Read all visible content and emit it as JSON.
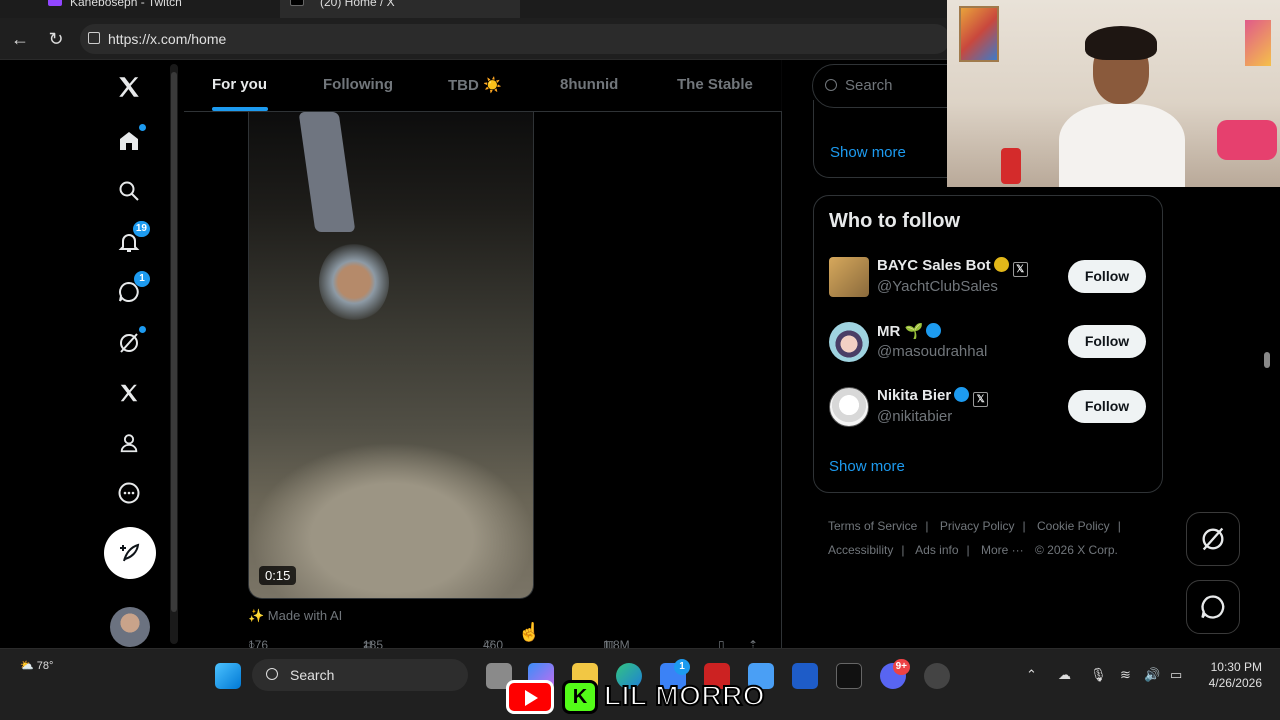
{
  "browser": {
    "tabs": [
      {
        "title": "Kaneboseph - Twitch"
      },
      {
        "title": "(20) Home / X"
      }
    ],
    "url": "https://x.com/home"
  },
  "sidebar": {
    "notifications_badge": "19",
    "messages_badge": "1"
  },
  "timeline": {
    "tabs": [
      {
        "label": "For you",
        "active": true
      },
      {
        "label": "Following"
      },
      {
        "label": "TBD ☀️"
      },
      {
        "label": "8hunnid"
      },
      {
        "label": "The Stable"
      }
    ],
    "post": {
      "duration": "0:15",
      "made_with_ai": "✨ Made with AI",
      "replies": "176",
      "reposts": "185",
      "likes": "460",
      "views": "1.8M"
    }
  },
  "right": {
    "search_placeholder": "Search",
    "show_more_top": "Show more",
    "who_to_follow": {
      "title": "Who to follow",
      "accounts": [
        {
          "name": "BAYC Sales Bot",
          "handle": "@YachtClubSales",
          "follow_label": "Follow",
          "badge_color": "#e2b719"
        },
        {
          "name": "MR 🌱",
          "handle": "@masoudrahhal",
          "follow_label": "Follow",
          "badge_color": "#1d9bf0"
        },
        {
          "name": "Nikita Bier",
          "handle": "@nikitabier",
          "follow_label": "Follow",
          "badge_color": "#1d9bf0"
        }
      ],
      "show_more": "Show more"
    },
    "footer": {
      "terms": "Terms of Service",
      "privacy": "Privacy Policy",
      "cookie": "Cookie Policy",
      "accessibility": "Accessibility",
      "ads": "Ads info",
      "more": "More ···",
      "copyright": "© 2026 X Corp."
    }
  },
  "taskbar": {
    "weather": "78°",
    "search_label": "Search",
    "time": "10:30 PM",
    "date": "4/26/2026",
    "store_badge": "1",
    "discord_badge": "9+"
  },
  "overlay": {
    "streamer_name": "LIL MORRO",
    "kick_letter": "K"
  },
  "colors": {
    "accent": "#1d9bf0",
    "background": "#000000",
    "border": "#2f3336",
    "muted_text": "#71767b"
  }
}
